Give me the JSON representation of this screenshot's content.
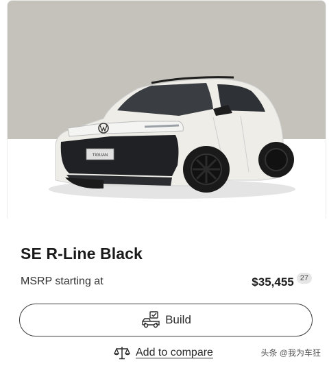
{
  "card": {
    "trim_name": "SE R-Line Black",
    "msrp_label": "MSRP starting at",
    "price": "$35,455",
    "footnote": "27",
    "build_label": "Build",
    "compare_label": "Add to compare",
    "car_badge": "TIGUAN"
  },
  "watermark": {
    "text": "头条 @我为车狂"
  },
  "icons": {
    "build": "car-configurator-icon",
    "compare": "balance-scale-icon"
  },
  "colors": {
    "hero_background": "#c4c2bb",
    "car_body": "#eeede8",
    "accent_dark": "#1b1b1b",
    "footnote_bg": "#e6e6e6"
  }
}
